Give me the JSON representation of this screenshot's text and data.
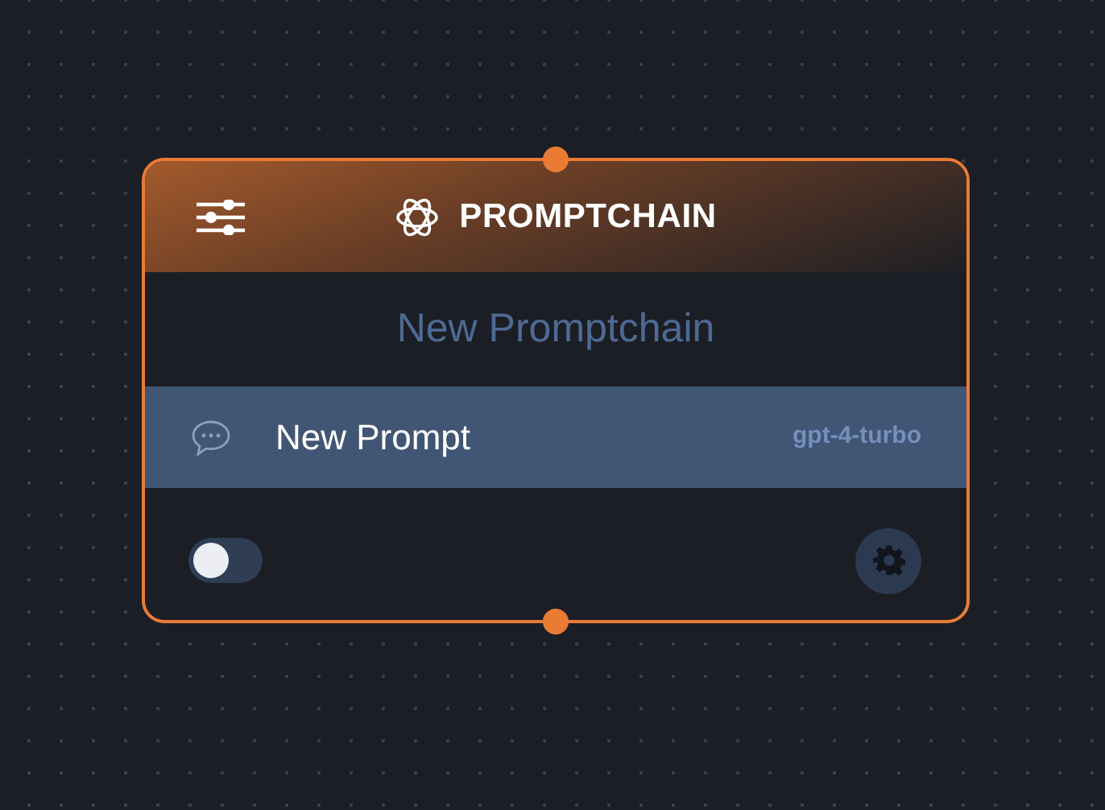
{
  "node": {
    "title": "PROMPTCHAIN",
    "name": "New Promptchain",
    "prompts": [
      {
        "label": "New Prompt",
        "model": "gpt-4-turbo",
        "selected": true
      }
    ],
    "toggle": {
      "on": false
    }
  }
}
